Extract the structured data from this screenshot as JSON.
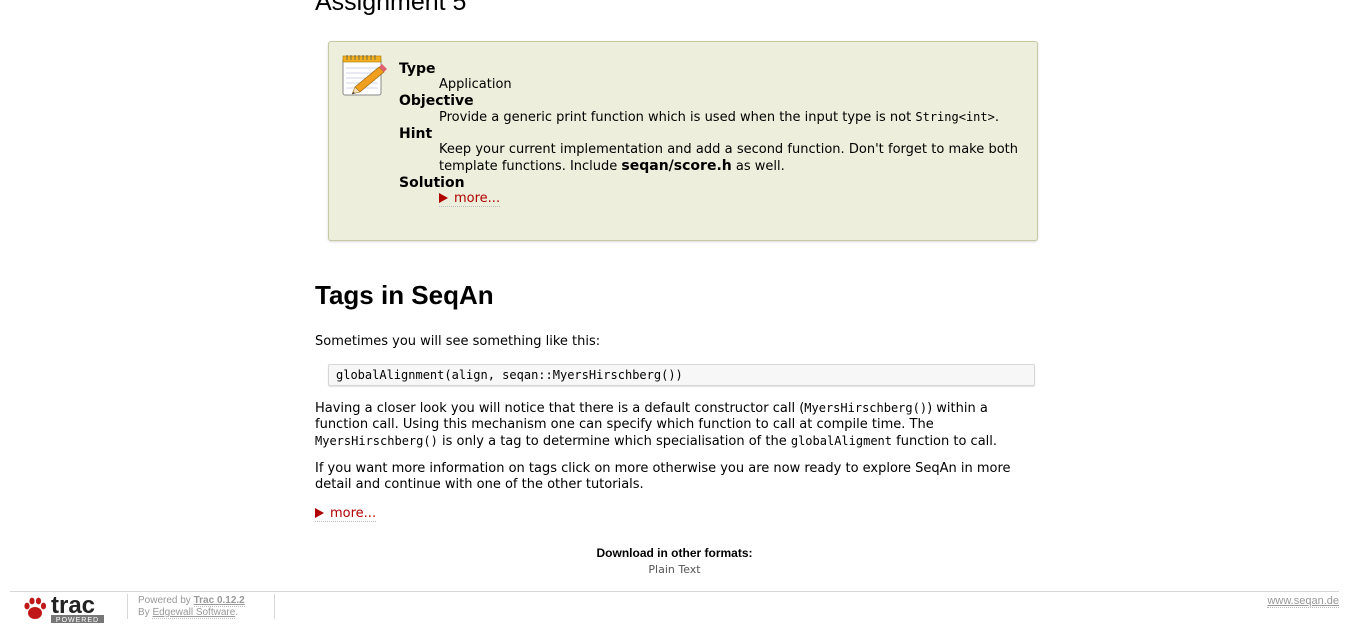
{
  "assignment": {
    "heading": "Assignment 5",
    "type_label": "Type",
    "type_value": "Application",
    "objective_label": "Objective",
    "objective_text": "Provide a generic print function which is used when the input type is not",
    "objective_code": "String<int>",
    "objective_end": ".",
    "hint_label": "Hint",
    "hint_text1": "Keep your current implementation and add a second function. Don't forget to make both template functions. Include",
    "hint_bold": "seqan/score.h",
    "hint_text2": "as well.",
    "solution_label": "Solution",
    "solution_more": "more..."
  },
  "tags": {
    "heading": "Tags in SeqAn",
    "intro": "Sometimes you will see something like this:",
    "code_line": "globalAlignment(align, seqan::MyersHirschberg())",
    "p1_a": "Having a closer look you will notice that there is a default constructor call (",
    "p1_code1": "MyersHirschberg()",
    "p1_b": ") within a function call. Using this mechanism one can specify which function to call at compile time. The",
    "p1_code2": "MyersHirschberg()",
    "p1_c": "is only a tag to determine which specialisation of the",
    "p1_code3": "globalAligment",
    "p1_d": "function to call.",
    "p2": "If you want more information on tags click on more otherwise you are now ready to explore SeqAn in more detail and continue with one of the other tutorials.",
    "more": "more..."
  },
  "download": {
    "title": "Download in other formats:",
    "format": "Plain Text"
  },
  "footer": {
    "logo_text": "trac",
    "logo_badge": "POWERED",
    "powered_by": "Powered by",
    "trac_version": "Trac 0.12.2",
    "by": "By",
    "edgewall": "Edgewall Software",
    "period": ".",
    "site": "www.seqan.de"
  },
  "colors": {
    "link_red": "#b00000",
    "assignment_bg": "#edeedb"
  },
  "icons": [
    "notepad-pencil-icon",
    "triangle-right-icon",
    "paw-icon"
  ]
}
